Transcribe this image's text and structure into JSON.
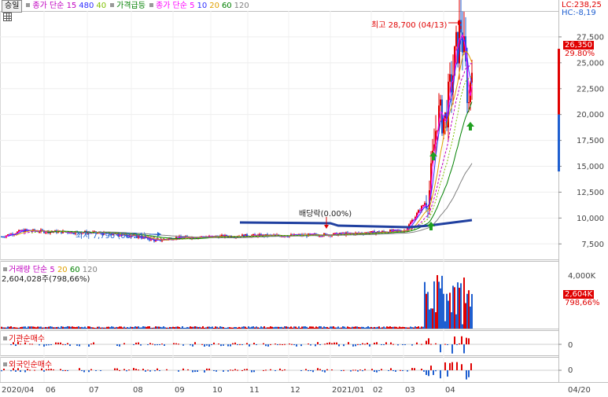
{
  "toolbar": {
    "tab_label": "승일",
    "legend": [
      {
        "text": "종가 단순 15",
        "color": "#c000c0"
      },
      {
        "text": "480",
        "color": "#3030ff"
      },
      {
        "text": "40",
        "color": "#80c000"
      },
      {
        "text": "가격급등",
        "color": "#008000"
      },
      {
        "text": "종가 단순 5",
        "color": "#ff00ff"
      },
      {
        "text": "10",
        "color": "#3030ff"
      },
      {
        "text": "20",
        "color": "#e0a000"
      },
      {
        "text": "60",
        "color": "#008000"
      },
      {
        "text": "120",
        "color": "#808080"
      }
    ],
    "grid_icon": "grid-icon"
  },
  "right_header": {
    "lc": "LC:238,25",
    "hc": "HC:-8,19"
  },
  "annotations": {
    "high": "최고 28,700 (04/13)",
    "low": "최저 7,790 (08/24)",
    "dividend": "배당락(0.00%)"
  },
  "price_tags": {
    "current": "26,350",
    "change": "29.80%"
  },
  "volume_panel": {
    "legend": [
      {
        "text": "거래량",
        "color": "#c000c0"
      },
      {
        "text": "단순 5",
        "color": "#c000c0"
      },
      {
        "text": "20",
        "color": "#e0a000"
      },
      {
        "text": "60",
        "color": "#008000"
      },
      {
        "text": "120",
        "color": "#808080"
      }
    ],
    "value_text": "2,604,028주(798,66%)",
    "tag": "2,604K",
    "tag_pct": "798,66%",
    "axis_max": "4,000K"
  },
  "inst_panel": {
    "title": "기관순매수",
    "zero": "0"
  },
  "foreign_panel": {
    "title": "외국인순매수",
    "zero": "0"
  },
  "colors": {
    "up": "#e00000",
    "down": "#1f5fd0",
    "accent_blue": "#2040a0"
  },
  "chart_data": {
    "type": "candlestick",
    "title": "승일",
    "x_ticks": [
      "2020/04",
      "06",
      "07",
      "08",
      "09",
      "10",
      "11",
      "12",
      "2021/01",
      "02",
      "03",
      "04",
      "04/20"
    ],
    "y_ticks": [
      "27,500",
      "25,000",
      "22,500",
      "20,000",
      "17,500",
      "15,000",
      "12,500",
      "10,000",
      "7,500"
    ],
    "ylim": [
      6000,
      30000
    ],
    "close_series": {
      "x": [
        "2020/04",
        "2020/05",
        "2020/06",
        "2020/07",
        "2020/08",
        "2020/08/24",
        "2020/09",
        "2020/10",
        "2020/11",
        "2020/12",
        "2021/01",
        "2021/02",
        "2021/03",
        "2021/03/15",
        "2021/03/25",
        "2021/04/01",
        "2021/04/08",
        "2021/04/13",
        "2021/04/16",
        "2021/04/20"
      ],
      "values": [
        8200,
        8800,
        8700,
        8600,
        8300,
        7790,
        8100,
        8200,
        8300,
        8300,
        8400,
        8600,
        8800,
        12000,
        20000,
        19500,
        25000,
        28700,
        21000,
        26350
      ]
    },
    "high": {
      "value": 28700,
      "date": "04/13"
    },
    "low": {
      "value": 7790,
      "date": "08/24"
    },
    "last_price": 26350,
    "last_change_pct": 29.8,
    "volume": {
      "last": 2604028,
      "last_pct": 798.66,
      "ylim": [
        0,
        4500000
      ]
    }
  }
}
